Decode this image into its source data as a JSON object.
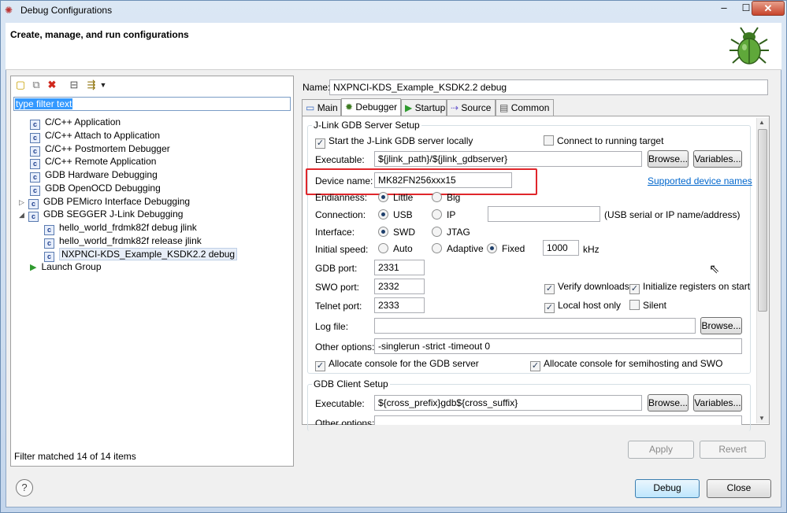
{
  "window": {
    "title": "Debug Configurations",
    "minimize_glyph": "–",
    "maximize_glyph": "☐",
    "close_glyph": "✕"
  },
  "header": {
    "title": "Create, manage, and run configurations"
  },
  "left": {
    "toolbar_icons": [
      "new-config-icon",
      "duplicate-icon",
      "delete-icon",
      "collapse-all-icon",
      "filter-icon",
      "dropdown-icon"
    ],
    "filter_text": "type filter text",
    "tree": [
      {
        "label": "C/C++ Application",
        "icon": "c-icon"
      },
      {
        "label": "C/C++ Attach to Application",
        "icon": "c-icon"
      },
      {
        "label": "C/C++ Postmortem Debugger",
        "icon": "c-icon"
      },
      {
        "label": "C/C++ Remote Application",
        "icon": "c-icon"
      },
      {
        "label": "GDB Hardware Debugging",
        "icon": "c-icon"
      },
      {
        "label": "GDB OpenOCD Debugging",
        "icon": "c-icon"
      },
      {
        "label": "GDB PEMicro Interface Debugging",
        "icon": "c-icon"
      },
      {
        "label": "GDB SEGGER J-Link Debugging",
        "icon": "c-icon"
      },
      {
        "label": "hello_world_frdmk82f debug jlink",
        "icon": "c-icon"
      },
      {
        "label": "hello_world_frdmk82f release jlink",
        "icon": "c-icon"
      },
      {
        "label": "NXPNCI-KDS_Example_KSDK2.2 debug",
        "icon": "c-icon"
      },
      {
        "label": "Launch Group",
        "icon": "launch-icon"
      }
    ],
    "status": "Filter matched 14 of 14 items"
  },
  "right": {
    "name_label": "Name:",
    "name_value": "NXPNCI-KDS_Example_KSDK2.2 debug",
    "tabs": [
      {
        "label": "Main",
        "icon": "main-icon"
      },
      {
        "label": "Debugger",
        "icon": "debugger-icon"
      },
      {
        "label": "Startup",
        "icon": "startup-icon"
      },
      {
        "label": "Source",
        "icon": "source-icon"
      },
      {
        "label": "Common",
        "icon": "common-icon"
      }
    ],
    "server": {
      "group_title": "J-Link GDB Server Setup",
      "start_locally": "Start the J-Link GDB server locally",
      "connect_running": "Connect to running target",
      "executable_label": "Executable:",
      "executable_value": "${jlink_path}/${jlink_gdbserver}",
      "browse": "Browse...",
      "variables": "Variables...",
      "device_label": "Device name:",
      "device_value": "MK82FN256xxx15",
      "supported_link": "Supported device names",
      "endianness_label": "Endianness:",
      "endianness_options": [
        "Little",
        "Big"
      ],
      "connection_label": "Connection:",
      "connection_options": [
        "USB",
        "IP"
      ],
      "connection_ip_value": "",
      "connection_hint": "(USB serial or IP name/address)",
      "interface_label": "Interface:",
      "interface_options": [
        "SWD",
        "JTAG"
      ],
      "speed_label": "Initial speed:",
      "speed_options": [
        "Auto",
        "Adaptive",
        "Fixed"
      ],
      "speed_value": "1000",
      "speed_unit": "kHz",
      "gdb_port_label": "GDB port:",
      "gdb_port_value": "2331",
      "swo_port_label": "SWO port:",
      "swo_port_value": "2332",
      "telnet_port_label": "Telnet port:",
      "telnet_port_value": "2333",
      "verify_downloads": "Verify downloads",
      "init_registers": "Initialize registers on start",
      "local_host_only": "Local host only",
      "silent": "Silent",
      "log_file_label": "Log file:",
      "log_file_value": "",
      "other_options_label": "Other options:",
      "other_options_value": "-singlerun -strict -timeout 0",
      "allocate_console_server": "Allocate console for the GDB server",
      "allocate_console_semihosting": "Allocate console for semihosting and SWO"
    },
    "client": {
      "group_title": "GDB Client Setup",
      "executable_label": "Executable:",
      "executable_value": "${cross_prefix}gdb${cross_suffix}",
      "browse": "Browse...",
      "variables": "Variables...",
      "other_options_label": "Other options:"
    },
    "apply": "Apply",
    "revert": "Revert"
  },
  "footer": {
    "help": "?",
    "debug": "Debug",
    "close": "Close"
  },
  "colors": {
    "highlight_border": "#e0262b",
    "link": "#0066cc",
    "selection": "#3399ff"
  }
}
